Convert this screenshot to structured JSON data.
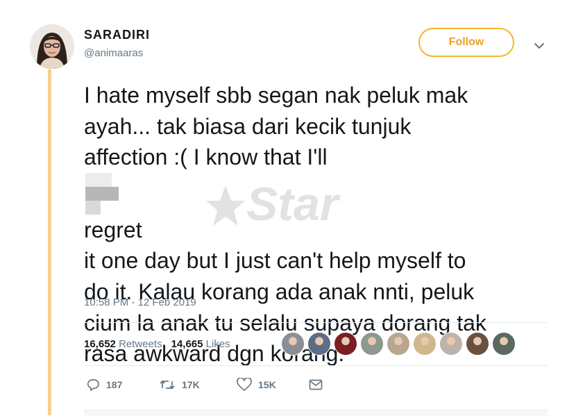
{
  "user": {
    "display_name": "SARADIRI",
    "handle": "@animaaras"
  },
  "follow_button": {
    "label": "Follow"
  },
  "tweet": {
    "lines": [
      "I hate myself sbb segan nak peluk mak",
      "ayah... tak biasa dari kecik tunjuk",
      "affection :( I know that I'll",
      "regret",
      "it one day but I just can't help myself to",
      "do it. Kalau korang ada anak nnti, peluk",
      "cium la anak tu selalu supaya dorang tak",
      "rasa awkward dgn korang."
    ],
    "timestamp": "10:58 PM - 12 Feb 2019"
  },
  "stats": {
    "retweets_count": "16,652",
    "retweets_label": "Retweets",
    "likes_count": "14,665",
    "likes_label": "Likes"
  },
  "likers_colors": [
    "#8a8f96",
    "#5d6c87",
    "#7a1f24",
    "#8c9a8e",
    "#b7a790",
    "#d1b78c",
    "#bdb3aa",
    "#6a5040",
    "#5a6a60"
  ],
  "actions": {
    "reply_count": "187",
    "retweet_count": "17K",
    "like_count": "15K"
  },
  "watermark": {
    "text": "Star"
  },
  "colors": {
    "accent_orange": "#f5b52b",
    "thread_line": "#f5d08c",
    "secondary_text": "#657786"
  }
}
